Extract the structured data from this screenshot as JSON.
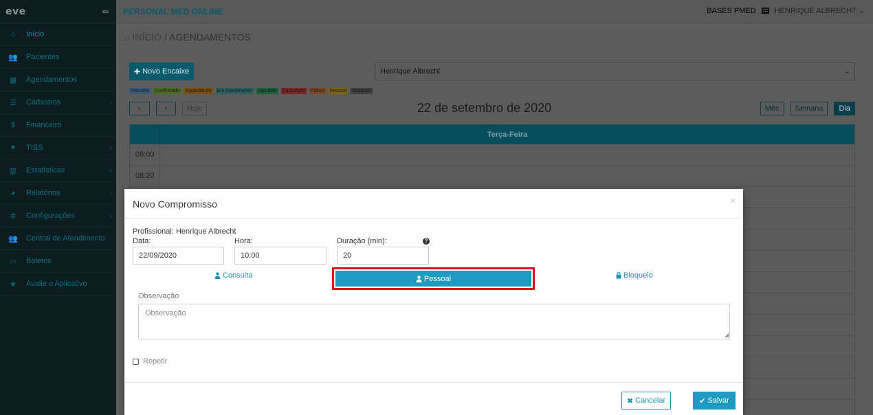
{
  "sidebar": {
    "logo": "eve",
    "items": [
      {
        "label": "Início",
        "icon": "home-icon",
        "chevron": false
      },
      {
        "label": "Pacientes",
        "icon": "users-icon",
        "chevron": false
      },
      {
        "label": "Agendamentos",
        "icon": "calendar-icon",
        "chevron": false
      },
      {
        "label": "Cadastros",
        "icon": "list-icon",
        "chevron": true
      },
      {
        "label": "Financeiro",
        "icon": "dollar-icon",
        "chevron": false
      },
      {
        "label": "TISS",
        "icon": "heartbeat-icon",
        "chevron": true
      },
      {
        "label": "Estatísticas",
        "icon": "bar-chart-icon",
        "chevron": true
      },
      {
        "label": "Relatórios",
        "icon": "pie-chart-icon",
        "chevron": true
      },
      {
        "label": "Configurações",
        "icon": "gear-icon",
        "chevron": true
      },
      {
        "label": "Central de Atendimento",
        "icon": "users-icon",
        "chevron": false
      },
      {
        "label": "Boletos",
        "icon": "money-icon",
        "chevron": false
      },
      {
        "label": "Avalie o Aplicativo",
        "icon": "star-icon",
        "chevron": false
      }
    ]
  },
  "topbar": {
    "app_name": "PERSONAL MED ONLINE",
    "bases": "BASES PMED",
    "user": "HENRIQUE ALBRECHT"
  },
  "breadcrumb": {
    "home": "INÍCIO",
    "separator": "/",
    "current": "AGENDAMENTOS"
  },
  "toolbar": {
    "encaixe_label": "Novo Encaixe",
    "professional_selected": "Henrique Albrecht"
  },
  "legend": [
    {
      "label": "Marcado",
      "color": "#3a5a78"
    },
    {
      "label": "Confirmado",
      "color": "#4b6b22"
    },
    {
      "label": "Aguardando",
      "color": "#7a5014"
    },
    {
      "label": "Em Atendimento",
      "color": "#2f5f5f"
    },
    {
      "label": "Atendido",
      "color": "#1f5f3c"
    },
    {
      "label": "Cancelado",
      "color": "#7a2727"
    },
    {
      "label": "Faltou",
      "color": "#7a4826"
    },
    {
      "label": "Pessoal",
      "color": "#7a6416"
    },
    {
      "label": "Bloqueio",
      "color": "#3f3f3f"
    }
  ],
  "calendar": {
    "today_label": "Hoje",
    "title": "22 de setembro de 2020",
    "views": {
      "month": "Mês",
      "week": "Semana",
      "day": "Dia"
    },
    "day_header": "Terça-Feira",
    "times": [
      "08:00",
      "08:20"
    ]
  },
  "modal": {
    "title": "Novo Compromisso",
    "close": "×",
    "professional_line": "Profissional: Henrique Albrecht",
    "date_label": "Data:",
    "date_value": "22/09/2020",
    "time_label": "Hora:",
    "time_value": "10:00",
    "duration_label": "Duração (min):",
    "duration_value": "20",
    "help": "?",
    "types": {
      "consulta": "Consulta",
      "pessoal": "Pessoal",
      "bloqueio": "Bloqueio"
    },
    "observation_label": "Observação",
    "observation_placeholder": "Observação",
    "repeat_label": "Repetir",
    "cancel_label": "Cancelar",
    "save_label": "Salvar"
  }
}
